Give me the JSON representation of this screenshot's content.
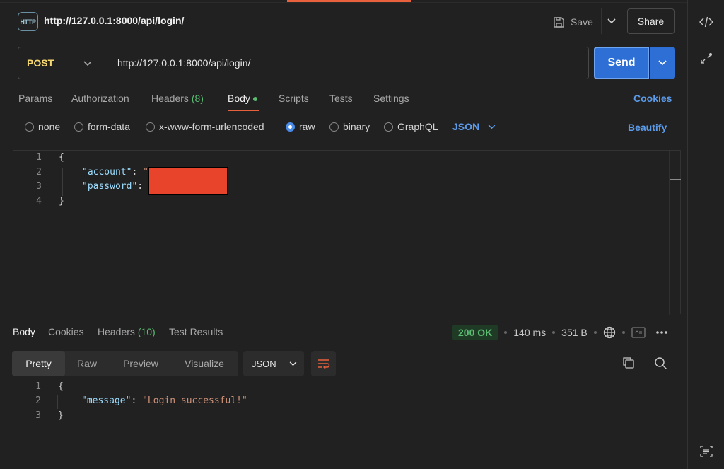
{
  "header": {
    "icon_text": "HTTP",
    "title": "http://127.0.0.1:8000/api/login/",
    "save_label": "Save",
    "share_label": "Share"
  },
  "request": {
    "method": "POST",
    "url": "http://127.0.0.1:8000/api/login/",
    "send_label": "Send"
  },
  "req_tabs": {
    "params": "Params",
    "authorization": "Authorization",
    "headers": "Headers",
    "headers_count": "(8)",
    "body": "Body",
    "scripts": "Scripts",
    "tests": "Tests",
    "settings": "Settings",
    "cookies": "Cookies"
  },
  "body_types": {
    "none": "none",
    "form_data": "form-data",
    "urlencoded": "x-www-form-urlencoded",
    "raw": "raw",
    "binary": "binary",
    "graphql": "GraphQL",
    "format": "JSON",
    "beautify": "Beautify",
    "selected": "raw"
  },
  "editor": {
    "line_numbers": [
      "1",
      "2",
      "3",
      "4"
    ],
    "open_brace": "{",
    "close_brace": "}",
    "key_account": "\"account\"",
    "key_password": "\"password\"",
    "colon": ": ",
    "quote": "\""
  },
  "resp_tabs": {
    "body": "Body",
    "cookies": "Cookies",
    "headers": "Headers",
    "headers_count": "(10)",
    "test_results": "Test Results"
  },
  "resp_meta": {
    "status": "200 OK",
    "time": "140 ms",
    "size": "351 B"
  },
  "resp_view": {
    "pretty": "Pretty",
    "raw": "Raw",
    "preview": "Preview",
    "visualize": "Visualize",
    "format": "JSON"
  },
  "response": {
    "line_numbers": [
      "1",
      "2",
      "3"
    ],
    "open_brace": "{",
    "close_brace": "}",
    "key": "\"message\"",
    "colon": ": ",
    "value": "\"Login successful!\""
  },
  "colors": {
    "accent": "#e8613c",
    "send": "#2e6fd6",
    "link": "#5b9bea",
    "success": "#5bbd72",
    "method": "#f5d76e",
    "redaction": "#e8432b"
  }
}
